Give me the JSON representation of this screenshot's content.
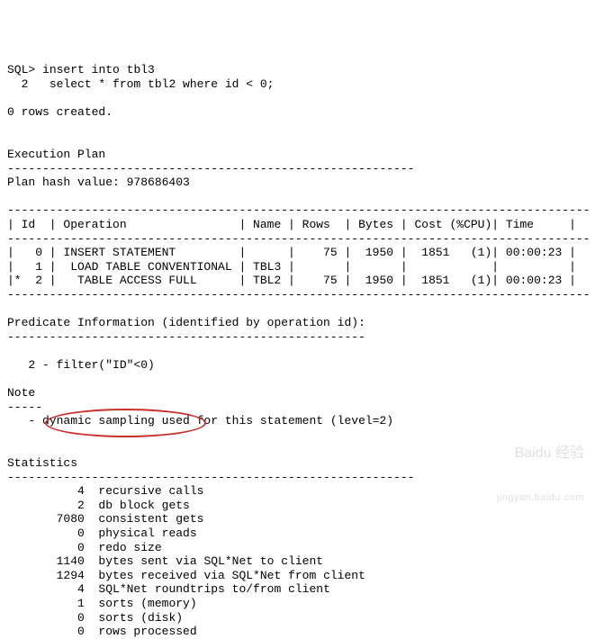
{
  "sql": {
    "prompt": "SQL>",
    "line1": "insert into tbl3",
    "line2_num": "  2 ",
    "line2": "  select * from tbl2 where id < 0;"
  },
  "result": "0 rows created.",
  "sections": {
    "execplan_title": "Execution Plan",
    "plan_hash": "Plan hash value: 978686403",
    "predicate_title": "Predicate Information (identified by operation id):",
    "predicate_line": "   2 - filter(\"ID\"<0)",
    "note_title": "Note",
    "note_line": "   - dynamic sampling used for this statement (level=2)",
    "stats_title": "Statistics"
  },
  "divider_long": "----------------------------------------------------------",
  "divider_short": "-----",
  "plan_divider": "-----------------------------------------------------------------------------------",
  "plan_header": "| Id  | Operation                | Name | Rows  | Bytes | Cost (%CPU)| Time     |",
  "plan_rows": [
    "|   0 | INSERT STATEMENT         |      |    75 |  1950 |  1851   (1)| 00:00:23 |",
    "|   1 |  LOAD TABLE CONVENTIONAL | TBL3 |       |       |            |          |",
    "|*  2 |   TABLE ACCESS FULL      | TBL2 |    75 |  1950 |  1851   (1)| 00:00:23 |"
  ],
  "predicate_divider": "---------------------------------------------------",
  "statistics": [
    {
      "value": "          4",
      "label": "  recursive calls"
    },
    {
      "value": "          2",
      "label": "  db block gets"
    },
    {
      "value": "       7080",
      "label": "  consistent gets"
    },
    {
      "value": "          0",
      "label": "  physical reads"
    },
    {
      "value": "          0",
      "label": "  redo size"
    },
    {
      "value": "       1140",
      "label": "  bytes sent via SQL*Net to client"
    },
    {
      "value": "       1294",
      "label": "  bytes received via SQL*Net from client"
    },
    {
      "value": "          4",
      "label": "  SQL*Net roundtrips to/from client"
    },
    {
      "value": "          1",
      "label": "  sorts (memory)"
    },
    {
      "value": "          0",
      "label": "  sorts (disk)"
    },
    {
      "value": "          0",
      "label": "  rows processed"
    }
  ],
  "watermark": {
    "main": "Baidu 经验",
    "sub": "jingyan.baidu.com"
  }
}
